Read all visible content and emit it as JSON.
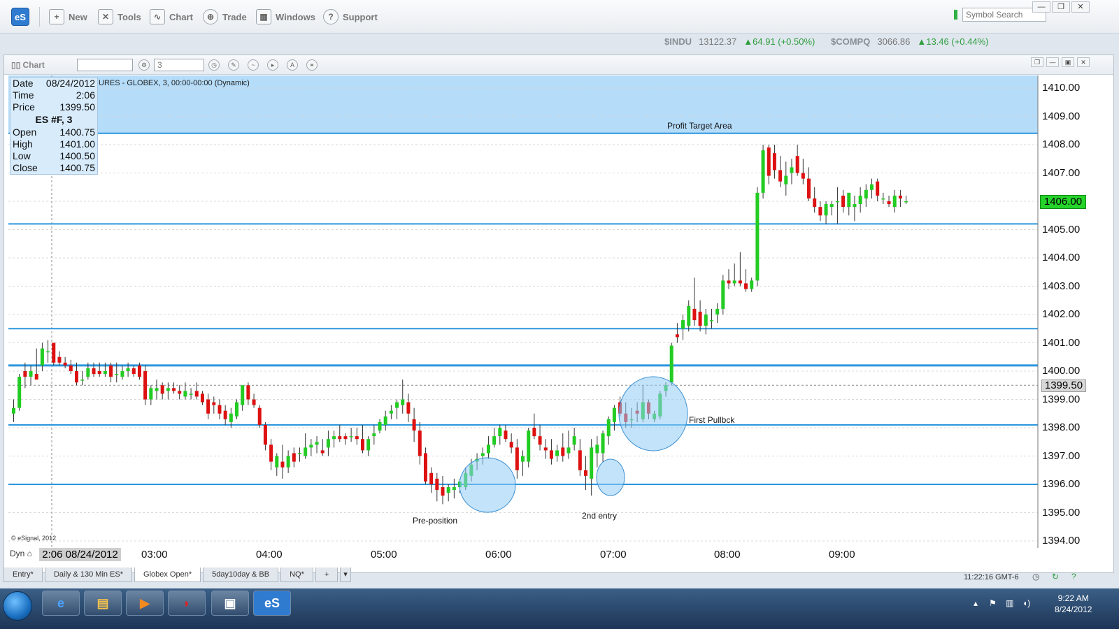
{
  "app": {
    "logo": "eS",
    "toolbar": [
      {
        "label": "New",
        "icon": "new-chart-icon"
      },
      {
        "label": "Tools",
        "icon": "tools-icon"
      },
      {
        "label": "Chart",
        "icon": "chart-icon"
      },
      {
        "label": "Trade",
        "icon": "trade-icon"
      },
      {
        "label": "Windows",
        "icon": "windows-icon"
      },
      {
        "label": "Support",
        "icon": "support-icon"
      }
    ],
    "symbol_search_placeholder": "Symbol Search"
  },
  "ticker": {
    "indu_symbol": "$INDU",
    "indu_price": "13122.37",
    "indu_change": "▲64.91 (+0.50%)",
    "compq_symbol": "$COMPQ",
    "compq_price": "3066.86",
    "compq_change": "▲13.46 (+0.44%)"
  },
  "chart_window": {
    "title": "Chart",
    "symbol_value": "",
    "interval_value": "3",
    "header": "URES - GLOBEX, 3, 00:00-00:00 (Dynamic)"
  },
  "data_window": {
    "date_label": "Date",
    "date": "08/24/2012",
    "time_label": "Time",
    "time": "2:06",
    "price_label": "Price",
    "price": "1399.50",
    "symbol": "ES #F, 3",
    "open_label": "Open",
    "open": "1400.75",
    "high_label": "High",
    "high": "1401.00",
    "low_label": "Low",
    "low": "1400.50",
    "close_label": "Close",
    "close": "1400.75"
  },
  "price_axis": [
    "1410.00",
    "1409.00",
    "1408.00",
    "1407.00",
    "1406.00",
    "1405.00",
    "1404.00",
    "1403.00",
    "1402.00",
    "1401.00",
    "1400.00",
    "1399.00",
    "1398.00",
    "1397.00",
    "1396.00",
    "1395.00",
    "1394.00"
  ],
  "current_price": "1406.00",
  "crosshair_price": "1399.50",
  "time_axis": [
    "03:00",
    "04:00",
    "05:00",
    "06:00",
    "07:00",
    "08:00",
    "09:00"
  ],
  "crosshair_time": "2:06 08/24/2012",
  "dyn_label": "Dyn",
  "copyright": "© eSignal, 2012",
  "annotations": {
    "profit_target": "Profit Target Area",
    "pre_position": "Pre-position",
    "second_entry": "2nd entry",
    "first_pullback": "First Pullbck"
  },
  "horizontal_levels": [
    1405.2,
    1401.5,
    1400.2,
    1398.1,
    1396.0
  ],
  "profit_zone": [
    1408.4,
    1410.0
  ],
  "candles_note": "3-minute ES futures bars",
  "candles": [
    [
      1398.5,
      1399.0,
      1398.2,
      1398.7
    ],
    [
      1398.7,
      1399.9,
      1398.6,
      1399.8
    ],
    [
      1400.0,
      1400.3,
      1399.4,
      1399.8
    ],
    [
      1399.8,
      1400.2,
      1399.5,
      1400.0
    ],
    [
      1399.9,
      1400.8,
      1399.7,
      1399.7
    ],
    [
      1400.2,
      1401.0,
      1400.0,
      1400.8
    ],
    [
      1400.7,
      1401.1,
      1400.3,
      1400.7
    ],
    [
      1401.0,
      1401.0,
      1400.2,
      1400.3
    ],
    [
      1400.5,
      1400.7,
      1400.2,
      1400.3
    ],
    [
      1400.3,
      1400.5,
      1400.1,
      1400.2
    ],
    [
      1400.2,
      1400.4,
      1399.9,
      1400.0
    ],
    [
      1400.0,
      1400.3,
      1399.5,
      1399.6
    ],
    [
      1399.7,
      1400.0,
      1399.5,
      1399.7
    ],
    [
      1399.8,
      1400.3,
      1399.7,
      1400.1
    ],
    [
      1400.1,
      1400.3,
      1399.8,
      1399.9
    ],
    [
      1400.0,
      1400.3,
      1399.8,
      1399.9
    ],
    [
      1399.9,
      1400.3,
      1399.8,
      1400.0
    ],
    [
      1400.2,
      1400.3,
      1399.6,
      1399.8
    ],
    [
      1399.9,
      1400.3,
      1399.6,
      1399.9
    ],
    [
      1399.8,
      1400.2,
      1399.7,
      1400.0
    ],
    [
      1400.0,
      1400.3,
      1399.8,
      1400.1
    ],
    [
      1400.1,
      1400.2,
      1399.8,
      1399.9
    ],
    [
      1400.2,
      1400.3,
      1399.7,
      1399.8
    ],
    [
      1400.0,
      1400.2,
      1398.8,
      1399.0
    ],
    [
      1399.0,
      1399.5,
      1398.8,
      1399.4
    ],
    [
      1399.3,
      1399.7,
      1399.0,
      1399.4
    ],
    [
      1399.5,
      1399.6,
      1399.0,
      1399.2
    ],
    [
      1399.3,
      1399.6,
      1399.0,
      1399.4
    ],
    [
      1399.4,
      1399.6,
      1399.2,
      1399.3
    ],
    [
      1399.3,
      1399.5,
      1399.0,
      1399.2
    ],
    [
      1399.1,
      1399.6,
      1399.0,
      1399.3
    ],
    [
      1399.2,
      1399.4,
      1399.0,
      1399.2
    ],
    [
      1399.3,
      1399.6,
      1399.0,
      1399.1
    ],
    [
      1399.2,
      1399.3,
      1398.8,
      1398.9
    ],
    [
      1399.0,
      1399.2,
      1398.3,
      1398.5
    ],
    [
      1398.9,
      1399.1,
      1398.5,
      1398.8
    ],
    [
      1398.8,
      1399.0,
      1398.3,
      1398.5
    ],
    [
      1398.6,
      1398.8,
      1398.1,
      1398.3
    ],
    [
      1398.2,
      1398.7,
      1398.0,
      1398.5
    ],
    [
      1398.4,
      1399.0,
      1398.3,
      1398.9
    ],
    [
      1398.8,
      1399.5,
      1398.6,
      1399.5
    ],
    [
      1399.5,
      1399.6,
      1398.8,
      1399.0
    ],
    [
      1399.0,
      1399.2,
      1398.7,
      1398.8
    ],
    [
      1398.7,
      1398.8,
      1398.0,
      1398.1
    ],
    [
      1398.1,
      1398.2,
      1397.2,
      1397.4
    ],
    [
      1397.4,
      1397.6,
      1396.5,
      1396.8
    ],
    [
      1396.6,
      1397.1,
      1396.3,
      1397.0
    ],
    [
      1396.8,
      1397.4,
      1396.2,
      1396.6
    ],
    [
      1396.6,
      1397.2,
      1396.4,
      1397.0
    ],
    [
      1397.1,
      1397.3,
      1396.6,
      1396.8
    ],
    [
      1397.1,
      1397.3,
      1396.8,
      1397.1
    ],
    [
      1397.0,
      1397.8,
      1396.9,
      1397.3
    ],
    [
      1397.3,
      1397.6,
      1397.0,
      1397.4
    ],
    [
      1397.4,
      1397.7,
      1397.1,
      1397.5
    ],
    [
      1397.2,
      1397.6,
      1397.0,
      1397.1
    ],
    [
      1397.3,
      1397.9,
      1397.0,
      1397.6
    ],
    [
      1397.6,
      1397.9,
      1397.3,
      1397.7
    ],
    [
      1397.7,
      1398.1,
      1397.5,
      1397.6
    ],
    [
      1397.7,
      1397.8,
      1397.4,
      1397.6
    ],
    [
      1397.7,
      1398.0,
      1397.5,
      1397.7
    ],
    [
      1397.7,
      1398.0,
      1397.4,
      1397.6
    ],
    [
      1397.6,
      1398.1,
      1397.1,
      1397.2
    ],
    [
      1397.2,
      1397.7,
      1397.0,
      1397.6
    ],
    [
      1397.7,
      1398.1,
      1397.4,
      1397.8
    ],
    [
      1397.9,
      1398.3,
      1397.8,
      1398.2
    ],
    [
      1398.1,
      1398.6,
      1397.9,
      1398.4
    ],
    [
      1398.5,
      1398.8,
      1398.3,
      1398.6
    ],
    [
      1398.7,
      1399.0,
      1398.3,
      1398.9
    ],
    [
      1398.8,
      1399.7,
      1398.5,
      1399.0
    ],
    [
      1398.9,
      1399.2,
      1398.2,
      1398.5
    ],
    [
      1398.3,
      1398.7,
      1397.5,
      1397.9
    ],
    [
      1397.9,
      1398.2,
      1396.7,
      1397.0
    ],
    [
      1397.1,
      1397.3,
      1396.0,
      1396.1
    ],
    [
      1396.4,
      1396.6,
      1395.7,
      1396.0
    ],
    [
      1396.2,
      1396.4,
      1395.4,
      1395.8
    ],
    [
      1395.9,
      1396.3,
      1395.3,
      1395.6
    ],
    [
      1395.7,
      1396.0,
      1395.4,
      1395.9
    ],
    [
      1395.8,
      1396.2,
      1395.5,
      1395.9
    ],
    [
      1395.9,
      1396.2,
      1395.7,
      1396.1
    ],
    [
      1395.9,
      1396.6,
      1395.8,
      1396.4
    ],
    [
      1396.3,
      1396.9,
      1396.1,
      1396.7
    ],
    [
      1396.8,
      1397.1,
      1396.5,
      1396.9
    ],
    [
      1397.0,
      1397.3,
      1396.7,
      1397.1
    ],
    [
      1397.1,
      1397.7,
      1396.9,
      1397.4
    ],
    [
      1397.4,
      1398.0,
      1397.3,
      1397.7
    ],
    [
      1397.7,
      1398.1,
      1397.4,
      1398.0
    ],
    [
      1397.9,
      1398.1,
      1397.5,
      1397.6
    ],
    [
      1397.5,
      1397.8,
      1397.1,
      1397.3
    ],
    [
      1397.3,
      1397.6,
      1396.2,
      1396.5
    ],
    [
      1396.8,
      1397.2,
      1396.3,
      1397.0
    ],
    [
      1396.8,
      1398.0,
      1396.6,
      1397.9
    ],
    [
      1398.0,
      1398.5,
      1397.6,
      1397.7
    ],
    [
      1397.7,
      1398.1,
      1397.2,
      1397.4
    ],
    [
      1397.3,
      1397.6,
      1396.9,
      1397.2
    ],
    [
      1397.2,
      1397.6,
      1396.7,
      1396.9
    ],
    [
      1397.0,
      1397.4,
      1396.8,
      1397.2
    ],
    [
      1397.3,
      1397.8,
      1396.8,
      1397.0
    ],
    [
      1397.1,
      1397.9,
      1396.9,
      1397.3
    ],
    [
      1397.4,
      1398.0,
      1397.2,
      1397.7
    ],
    [
      1397.2,
      1397.6,
      1396.3,
      1396.5
    ],
    [
      1396.5,
      1397.0,
      1395.8,
      1396.3
    ],
    [
      1396.2,
      1397.6,
      1395.6,
      1397.3
    ],
    [
      1397.1,
      1397.7,
      1396.6,
      1397.4
    ],
    [
      1397.1,
      1397.9,
      1396.8,
      1397.8
    ],
    [
      1397.7,
      1398.4,
      1397.4,
      1398.3
    ],
    [
      1398.2,
      1398.8,
      1397.9,
      1398.7
    ],
    [
      1398.9,
      1399.1,
      1398.4,
      1398.5
    ],
    [
      1398.5,
      1398.9,
      1398.0,
      1398.2
    ],
    [
      1398.3,
      1398.7,
      1398.0,
      1398.3
    ],
    [
      1398.6,
      1398.9,
      1398.2,
      1398.5
    ],
    [
      1398.3,
      1399.5,
      1398.2,
      1398.9
    ],
    [
      1398.9,
      1399.0,
      1398.3,
      1398.5
    ],
    [
      1398.3,
      1398.6,
      1398.2,
      1398.5
    ],
    [
      1398.4,
      1399.3,
      1398.3,
      1399.2
    ],
    [
      1399.3,
      1399.6,
      1399.1,
      1399.5
    ],
    [
      1399.6,
      1401.0,
      1399.5,
      1400.9
    ],
    [
      1401.3,
      1401.7,
      1401.0,
      1401.2
    ],
    [
      1401.5,
      1402.0,
      1401.1,
      1401.8
    ],
    [
      1401.6,
      1402.5,
      1401.4,
      1402.3
    ],
    [
      1402.2,
      1403.3,
      1401.6,
      1401.8
    ],
    [
      1402.1,
      1402.5,
      1401.4,
      1401.6
    ],
    [
      1401.6,
      1402.2,
      1401.3,
      1402.0
    ],
    [
      1401.8,
      1402.2,
      1401.5,
      1401.8
    ],
    [
      1402.0,
      1402.4,
      1401.7,
      1402.2
    ],
    [
      1402.2,
      1403.4,
      1402.0,
      1403.2
    ],
    [
      1403.2,
      1403.6,
      1402.9,
      1403.1
    ],
    [
      1403.1,
      1403.8,
      1403.0,
      1403.2
    ],
    [
      1403.2,
      1404.2,
      1403.0,
      1403.1
    ],
    [
      1403.1,
      1403.6,
      1402.8,
      1402.9
    ],
    [
      1402.9,
      1403.3,
      1402.8,
      1403.2
    ],
    [
      1403.2,
      1406.5,
      1403.0,
      1406.3
    ],
    [
      1406.3,
      1408.0,
      1406.1,
      1407.8
    ],
    [
      1407.9,
      1408.0,
      1406.6,
      1406.9
    ],
    [
      1407.7,
      1408.0,
      1406.8,
      1407.1
    ],
    [
      1407.1,
      1407.6,
      1406.5,
      1406.7
    ],
    [
      1406.6,
      1407.4,
      1406.2,
      1406.9
    ],
    [
      1407.0,
      1407.5,
      1406.6,
      1407.2
    ],
    [
      1407.6,
      1408.0,
      1406.9,
      1407.0
    ],
    [
      1407.0,
      1407.5,
      1406.6,
      1406.8
    ],
    [
      1406.8,
      1407.2,
      1406.0,
      1406.1
    ],
    [
      1406.1,
      1406.5,
      1405.6,
      1405.8
    ],
    [
      1405.8,
      1406.0,
      1405.3,
      1405.5
    ],
    [
      1405.5,
      1406.0,
      1405.2,
      1405.9
    ],
    [
      1405.8,
      1406.0,
      1405.5,
      1405.9
    ],
    [
      1406.0,
      1406.5,
      1405.2,
      1406.0
    ],
    [
      1406.2,
      1406.4,
      1405.6,
      1405.8
    ],
    [
      1405.8,
      1406.3,
      1405.5,
      1406.3
    ],
    [
      1405.8,
      1406.2,
      1405.3,
      1405.9
    ],
    [
      1405.9,
      1406.5,
      1405.6,
      1406.2
    ],
    [
      1406.1,
      1406.6,
      1405.8,
      1406.4
    ],
    [
      1406.4,
      1406.8,
      1406.1,
      1406.6
    ],
    [
      1406.7,
      1406.8,
      1406.0,
      1406.2
    ],
    [
      1406.1,
      1406.3,
      1405.9,
      1406.1
    ],
    [
      1406.0,
      1406.2,
      1405.8,
      1405.9
    ],
    [
      1405.8,
      1406.4,
      1405.6,
      1406.2
    ],
    [
      1406.2,
      1406.4,
      1405.8,
      1406.1
    ],
    [
      1406.0,
      1406.2,
      1405.9,
      1406.0
    ]
  ],
  "tabs": [
    "Entry*",
    "Daily & 130 Min ES*",
    "Globex Open*",
    "5day10day & BB",
    "NQ*",
    "+"
  ],
  "active_tab": "Globex Open*",
  "status_time": "11:22:16 GMT-6",
  "clock": {
    "time": "9:22 AM",
    "date": "8/24/2012"
  },
  "colors": {
    "up": "#22cc22",
    "down": "#dd1111",
    "level": "#2b96dd",
    "zone": "#b5dcf9",
    "circle": "#8fccf5"
  }
}
